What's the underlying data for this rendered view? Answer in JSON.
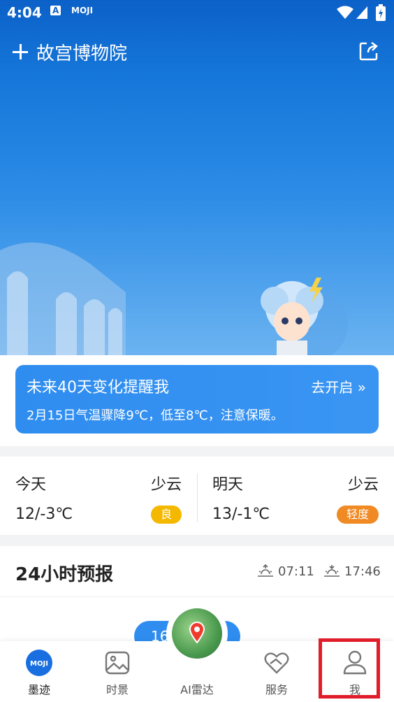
{
  "status_bar": {
    "time": "4:04",
    "app_icon_text": "MOJI",
    "a_icon": "A"
  },
  "header": {
    "location": "故宫博物院"
  },
  "reminder": {
    "title": "未来40天变化提醒我",
    "action": "去开启 »",
    "description": "2月15日气温骤降9℃，低至8℃，注意保暖。"
  },
  "days": [
    {
      "name": "今天",
      "condition": "少云",
      "temp": "12/-3℃",
      "aqi": "良",
      "aqi_color": "#f5b800"
    },
    {
      "name": "明天",
      "condition": "少云",
      "temp": "13/-1℃",
      "aqi": "轻度",
      "aqi_color": "#f08a24"
    }
  ],
  "forecast": {
    "title": "24小时预报",
    "sunrise": "07:11",
    "sunset": "17:46",
    "first_temp": "16"
  },
  "nav": [
    {
      "label": "墨迹",
      "icon": "moji-logo-icon"
    },
    {
      "label": "时景",
      "icon": "picture-icon"
    },
    {
      "label": "AI雷达",
      "icon": "radar-map-icon"
    },
    {
      "label": "服务",
      "icon": "service-heart-icon"
    },
    {
      "label": "我",
      "icon": "person-icon"
    }
  ],
  "colors": {
    "accent": "#2f8df0",
    "highlight": "#e11d2a"
  }
}
